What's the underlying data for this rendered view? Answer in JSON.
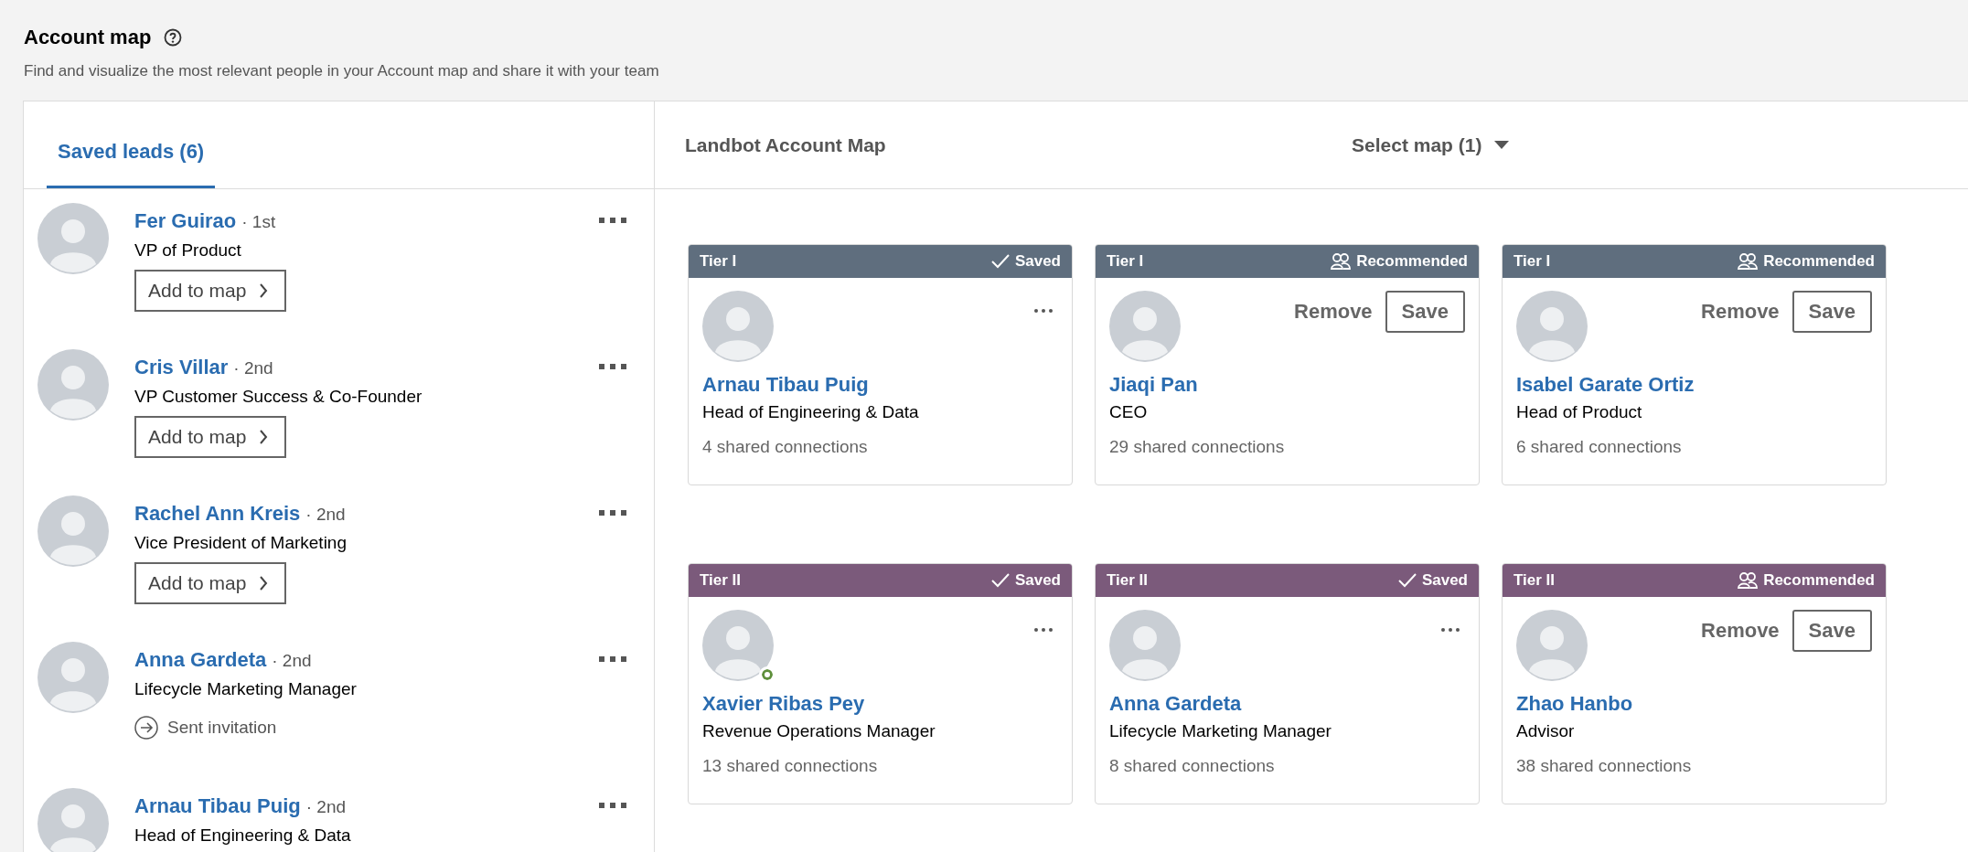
{
  "header": {
    "title": "Account map",
    "subtitle": "Find and visualize the most relevant people in your Account map and share it with your team"
  },
  "tabs": [
    {
      "label": "Saved leads (6)",
      "selected": true
    }
  ],
  "leads": [
    {
      "name": "Fer Guirao",
      "degree": "· 1st",
      "title": "VP of Product",
      "action": {
        "kind": "add",
        "label": "Add to map"
      }
    },
    {
      "name": "Cris Villar",
      "degree": "· 2nd",
      "title": "VP Customer Success & Co-Founder",
      "action": {
        "kind": "add",
        "label": "Add to map"
      }
    },
    {
      "name": "Rachel Ann Kreis",
      "degree": "· 2nd",
      "title": "Vice President of Marketing",
      "action": {
        "kind": "add",
        "label": "Add to map"
      }
    },
    {
      "name": "Anna Gardeta",
      "degree": "· 2nd",
      "title": "Lifecycle Marketing Manager",
      "action": {
        "kind": "invited",
        "label": "Sent invitation"
      }
    },
    {
      "name": "Arnau Tibau Puig",
      "degree": "· 2nd",
      "title": "Head of Engineering & Data"
    }
  ],
  "map": {
    "title": "Landbot Account Map",
    "select": "Select map (1)",
    "cards": [
      {
        "tier": "Tier I",
        "color": "#5f6e7e",
        "status": {
          "kind": "saved",
          "label": "Saved"
        },
        "name": "Arnau Tibau Puig",
        "title": "Head of Engineering & Data",
        "connections": "4 shared connections",
        "online": false
      },
      {
        "tier": "Tier I",
        "color": "#5f6e7e",
        "status": {
          "kind": "recommended",
          "label": "Recommended"
        },
        "name": "Jiaqi Pan",
        "title": "CEO",
        "connections": "29 shared connections",
        "online": false,
        "buttons": [
          "Remove",
          "Save"
        ]
      },
      {
        "tier": "Tier I",
        "color": "#5f6e7e",
        "status": {
          "kind": "recommended",
          "label": "Recommended"
        },
        "name": "Isabel Garate Ortiz",
        "title": "Head of Product",
        "connections": "6 shared connections",
        "online": false,
        "buttons": [
          "Remove",
          "Save"
        ]
      },
      {
        "tier": "Tier II",
        "color": "#7b5a7b",
        "status": {
          "kind": "saved",
          "label": "Saved"
        },
        "name": "Xavier Ribas Pey",
        "title": "Revenue Operations Manager",
        "connections": "13 shared connections",
        "online": true
      },
      {
        "tier": "Tier II",
        "color": "#7b5a7b",
        "status": {
          "kind": "saved",
          "label": "Saved"
        },
        "name": "Anna Gardeta",
        "title": "Lifecycle Marketing Manager",
        "connections": "8 shared connections",
        "online": false
      },
      {
        "tier": "Tier II",
        "color": "#7b5a7b",
        "status": {
          "kind": "recommended",
          "label": "Recommended"
        },
        "name": "Zhao Hanbo",
        "title": "Advisor",
        "connections": "38 shared connections",
        "online": false,
        "buttons": [
          "Remove",
          "Save"
        ]
      }
    ]
  }
}
